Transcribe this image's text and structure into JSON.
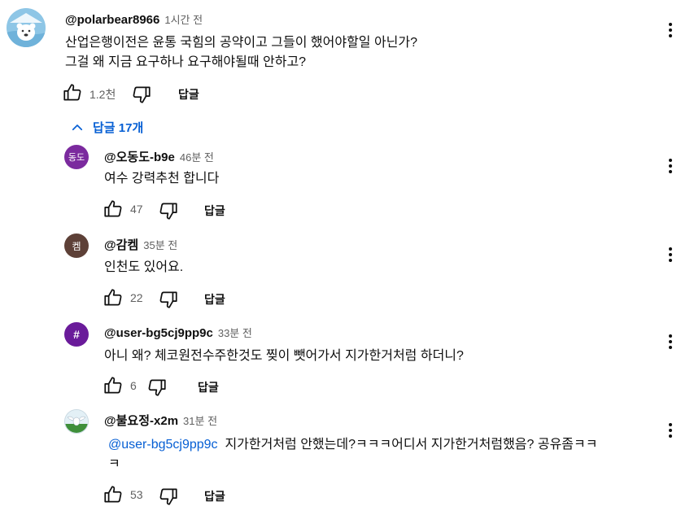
{
  "main_comment": {
    "author": "@polarbear8966",
    "time": "1시간 전",
    "text_line1": "산업은행이전은 윤통 국힘의 공약이고 그들이 했어야할일 아닌가?",
    "text_line2": "그걸 왜 지금 요구하나 요구해야될때 안하고?",
    "likes": "1.2천",
    "reply_label": "답글"
  },
  "replies_toggle": {
    "label": "답글 17개"
  },
  "replies": [
    {
      "avatar_text": "동도",
      "avatar_color": "#7b2a9e",
      "author": "@오동도-b9e",
      "time": "46분 전",
      "text": "여수 강력추천 합니다",
      "likes": "47",
      "reply_label": "답글"
    },
    {
      "avatar_text": "켐",
      "avatar_color": "#5d4037",
      "author": "@감켐",
      "time": "35분 전",
      "text": "인천도 있어요.",
      "likes": "22",
      "reply_label": "답글"
    },
    {
      "avatar_text": "#",
      "avatar_color": "#6a1b9a",
      "author": "@user-bg5cj9pp9c",
      "time": "33분 전",
      "text": "아니 왜? 체코원전수주한것도 찢이 뺏어가서 지가한거처럼 하더니?",
      "likes": "6",
      "reply_label": "답글"
    },
    {
      "avatar_text": "",
      "avatar_color": "#e3f0f6",
      "author": "@불요정-x2m",
      "time": "31분 전",
      "mention": "@user-bg5cj9pp9c",
      "text_line1": "지가한거처럼 안했는데?ㅋㅋㅋ어디서 지가한거처럼했음? 공유좀ㅋㅋ",
      "text_line2": "ㅋ",
      "likes": "53",
      "reply_label": "답글"
    }
  ],
  "icons": {
    "like": "thumbs-up-icon",
    "dislike": "thumbs-down-icon",
    "more": "kebab-menu-icon",
    "collapse": "chevron-up-icon"
  }
}
